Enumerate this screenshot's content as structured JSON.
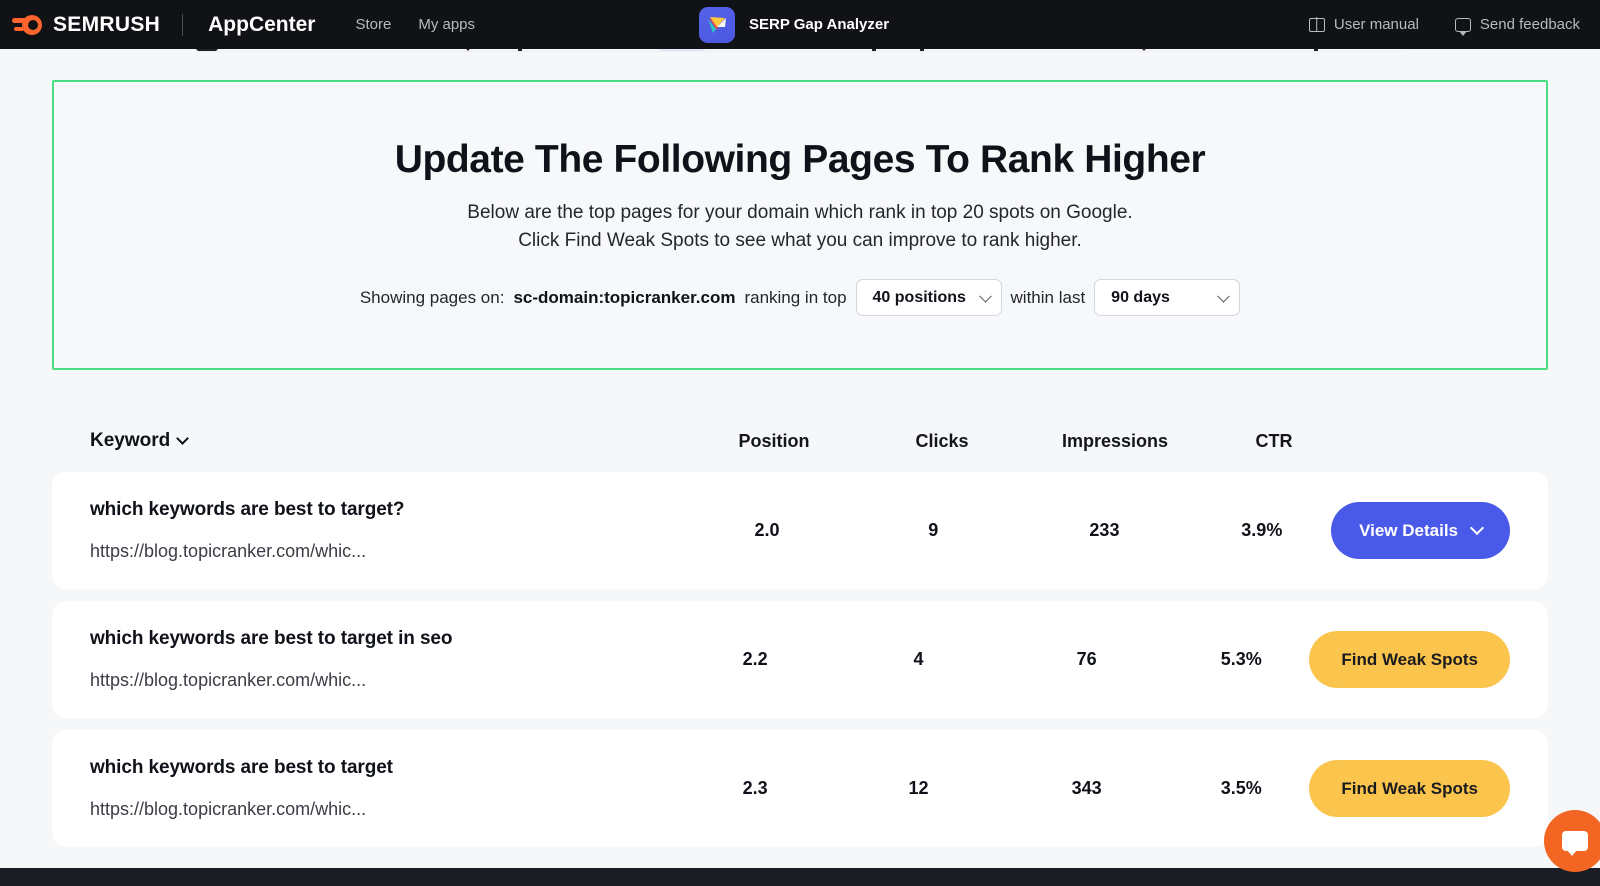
{
  "topbar": {
    "brand": "SEMRUSH",
    "product": "AppCenter",
    "links": [
      {
        "label": "Store"
      },
      {
        "label": "My apps"
      }
    ],
    "app_name": "SERP Gap Analyzer",
    "app_icon": "bird-icon",
    "right_items": [
      {
        "label": "User manual",
        "icon": "book-icon"
      },
      {
        "label": "Send feedback",
        "icon": "chat-icon"
      }
    ]
  },
  "hero": {
    "title": "Update The Following Pages To Rank Higher",
    "subtitle_line1": "Below are the top pages for your domain which rank in top 20 spots on Google.",
    "subtitle_line2": "Click Find Weak Spots to see what you can improve to rank higher.",
    "border_color": "#4ade80",
    "controls": {
      "prefix": "Showing pages on:",
      "domain": "sc-domain:topicranker.com",
      "middle": "ranking in top",
      "positions_value": "40 positions",
      "between": "within last",
      "days_value": "90 days"
    }
  },
  "table": {
    "columns": [
      {
        "key": "keyword",
        "label": "Keyword",
        "sortable": true
      },
      {
        "key": "position",
        "label": "Position"
      },
      {
        "key": "clicks",
        "label": "Clicks"
      },
      {
        "key": "impressions",
        "label": "Impressions"
      },
      {
        "key": "ctr",
        "label": "CTR"
      }
    ],
    "rows": [
      {
        "keyword": "which keywords are best to target?",
        "url": "https://blog.topicranker.com/whic...",
        "position": "2.0",
        "clicks": "9",
        "impressions": "233",
        "ctr": "3.9%",
        "action_label": "View Details",
        "action_style": "primary",
        "action_has_chevron": true
      },
      {
        "keyword": "which keywords are best to target in seo",
        "url": "https://blog.topicranker.com/whic...",
        "position": "2.2",
        "clicks": "4",
        "impressions": "76",
        "ctr": "5.3%",
        "action_label": "Find Weak Spots",
        "action_style": "warn",
        "action_has_chevron": false
      },
      {
        "keyword": "which keywords are best to target",
        "url": "https://blog.topicranker.com/whic...",
        "position": "2.3",
        "clicks": "12",
        "impressions": "343",
        "ctr": "3.5%",
        "action_label": "Find Weak Spots",
        "action_style": "warn",
        "action_has_chevron": false
      }
    ]
  },
  "support_widget": {
    "icon": "chat-bubble-icon"
  },
  "colors": {
    "accent_blue": "#4a5ae8",
    "accent_yellow": "#fbc44d",
    "brand_orange": "#ff642d",
    "panel_border_green": "#4ade80",
    "topbar_bg": "#111216",
    "page_bg": "#f6f7f9"
  }
}
